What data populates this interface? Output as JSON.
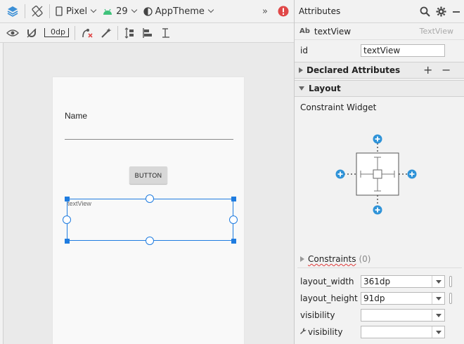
{
  "toolbar": {
    "device": "Pixel",
    "api_level": "29",
    "theme": "AppTheme",
    "more": "»",
    "margin_value": "0dp"
  },
  "canvas": {
    "name_label": "Name",
    "button_label": "BUTTON",
    "textview_text": "textView"
  },
  "attributes": {
    "title": "Attributes",
    "component_icon_text": "Ab",
    "component_name": "textView",
    "component_type": "TextView",
    "id_label": "id",
    "id_value": "textView",
    "declared_section": "Declared Attributes",
    "layout_section": "Layout",
    "constraint_widget_label": "Constraint Widget",
    "constraints_label": "Constraints",
    "constraints_count": "(0)",
    "props": [
      {
        "label": "layout_width",
        "value": "361dp"
      },
      {
        "label": "layout_height",
        "value": "91dp"
      },
      {
        "label": "visibility",
        "value": ""
      },
      {
        "label": "visibility",
        "value": ""
      }
    ],
    "add_symbol": "+",
    "remove_symbol": "−"
  },
  "colors": {
    "accent": "#1f7ce0",
    "constraint_add": "#2f93d8",
    "error": "#e04848"
  }
}
